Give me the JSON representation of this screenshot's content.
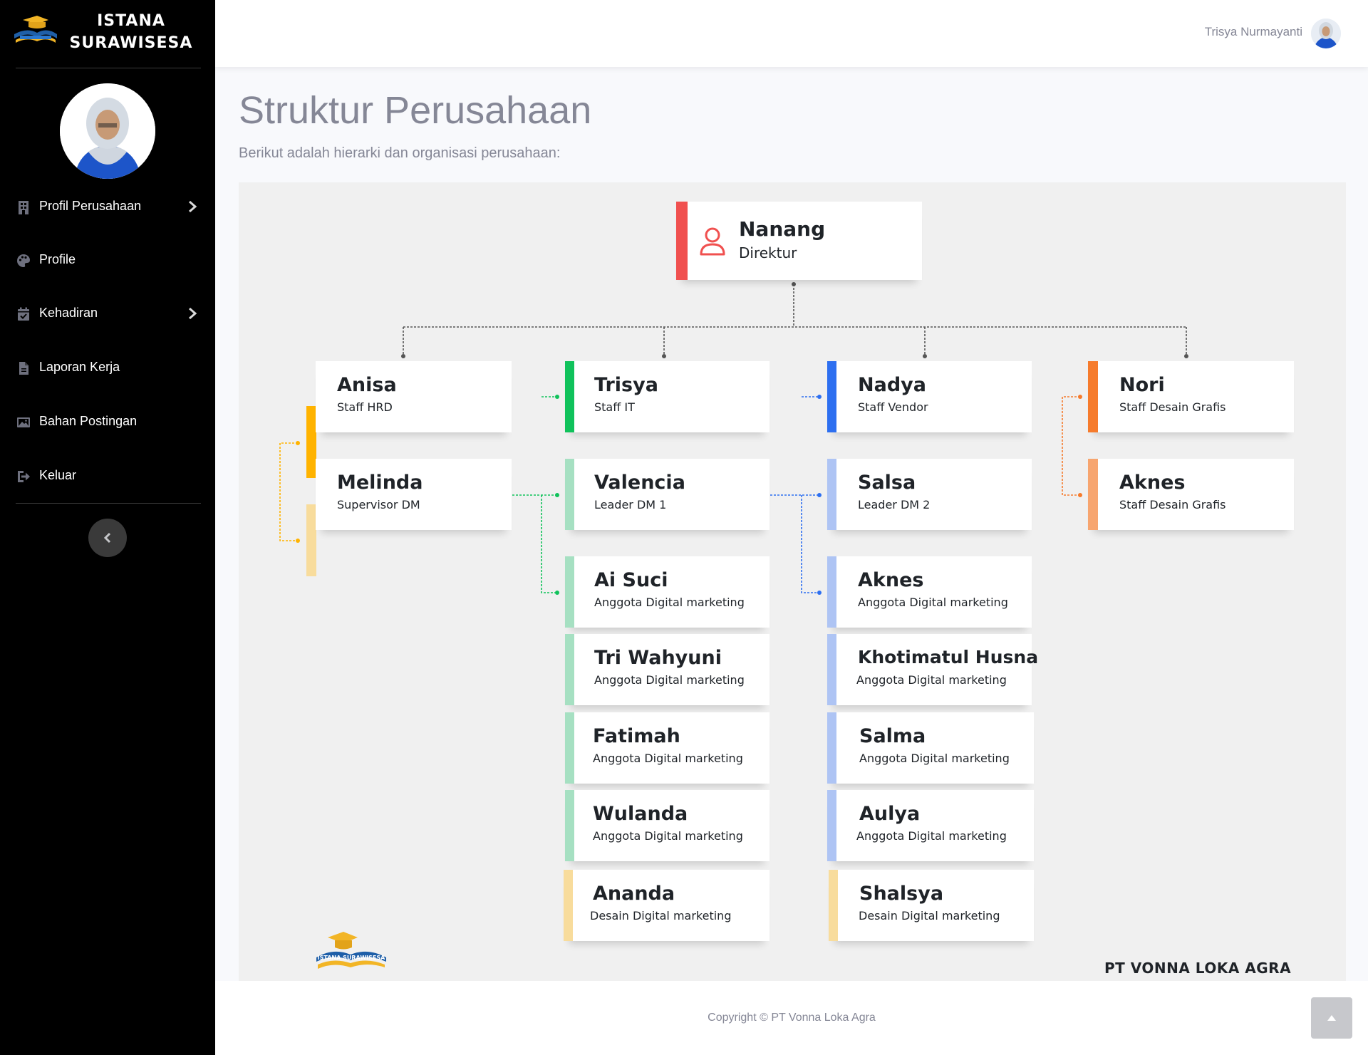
{
  "brand": {
    "line1": "ISTANA",
    "line2": "SURAWISESA"
  },
  "sidebar": {
    "items": [
      {
        "label": "Profil Perusahaan",
        "icon": "building-icon",
        "has_submenu": true
      },
      {
        "label": "Profile",
        "icon": "palette-icon",
        "has_submenu": false
      },
      {
        "label": "Kehadiran",
        "icon": "calendar-check-icon",
        "has_submenu": true
      },
      {
        "label": "Laporan Kerja",
        "icon": "file-icon",
        "has_submenu": false
      },
      {
        "label": "Bahan Postingan",
        "icon": "image-icon",
        "has_submenu": false
      },
      {
        "label": "Keluar",
        "icon": "sign-out-icon",
        "has_submenu": false
      }
    ]
  },
  "topbar": {
    "user_name": "Trisya Nurmayanti"
  },
  "page": {
    "title": "Struktur Perusahaan",
    "subtitle": "Berikut adalah hierarki dan organisasi perusahaan:"
  },
  "org_chart": {
    "director": {
      "name": "Nanang",
      "role": "Direktur",
      "color": "#f0504f"
    },
    "columns": [
      {
        "color": "#ffb300",
        "members": [
          {
            "name": "Anisa",
            "role": "Staff HRD"
          },
          {
            "name": "Melinda",
            "role": "Supervisor DM"
          }
        ]
      },
      {
        "color": "#10c25b",
        "members": [
          {
            "name": "Trisya",
            "role": "Staff IT"
          },
          {
            "name": "Valencia",
            "role": "Leader DM 1"
          },
          {
            "name": "Ai Suci",
            "role": "Anggota Digital marketing"
          },
          {
            "name": "Tri Wahyuni",
            "role": "Anggota Digital marketing"
          },
          {
            "name": "Fatimah",
            "role": "Anggota Digital marketing"
          },
          {
            "name": "Wulanda",
            "role": "Anggota Digital marketing"
          },
          {
            "name": "Ananda",
            "role": "Desain Digital marketing"
          }
        ]
      },
      {
        "color": "#2d6ff0",
        "members": [
          {
            "name": "Nadya",
            "role": "Staff Vendor"
          },
          {
            "name": "Salsa",
            "role": "Leader DM 2"
          },
          {
            "name": "Aknes",
            "role": "Anggota Digital marketing"
          },
          {
            "name": "Khotimatul Husna",
            "role": "Anggota Digital marketing"
          },
          {
            "name": "Salma",
            "role": "Anggota Digital marketing"
          },
          {
            "name": "Aulya",
            "role": "Anggota Digital marketing"
          },
          {
            "name": "Shalsya",
            "role": "Desain Digital marketing"
          }
        ]
      },
      {
        "color": "#f67b2c",
        "members": [
          {
            "name": "Nori",
            "role": "Staff Desain Grafis"
          },
          {
            "name": "Aknes",
            "role": "Staff Desain Grafis"
          }
        ]
      }
    ],
    "chart_logo_text": "ISTANA SURAWISESA",
    "company": "PT VONNA LOKA AGRA"
  },
  "footer": {
    "copyright": "Copyright © PT Vonna Loka Agra"
  },
  "colors": {
    "sidebar_bg": "#000000",
    "panel_bg": "#f0f0f0",
    "text_muted": "#858796",
    "red": "#f0504f",
    "yellow": "#ffb300",
    "green": "#10c25b",
    "blue": "#2d6ff0",
    "orange": "#f67b2c"
  }
}
